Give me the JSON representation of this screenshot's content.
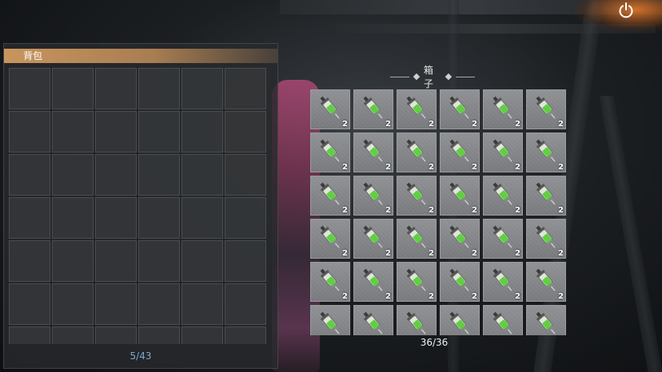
{
  "backpack": {
    "title": "背包",
    "capacity_text": "5/43",
    "visible_slot_count": 42
  },
  "box": {
    "title": "箱子",
    "capacity_text": "36/36",
    "item_icon": "green-syringe-icon",
    "slots": [
      {
        "qty": "2"
      },
      {
        "qty": "2"
      },
      {
        "qty": "2"
      },
      {
        "qty": "2"
      },
      {
        "qty": "2"
      },
      {
        "qty": "2"
      },
      {
        "qty": "2"
      },
      {
        "qty": "2"
      },
      {
        "qty": "2"
      },
      {
        "qty": "2"
      },
      {
        "qty": "2"
      },
      {
        "qty": "2"
      },
      {
        "qty": "2"
      },
      {
        "qty": "2"
      },
      {
        "qty": "2"
      },
      {
        "qty": "2"
      },
      {
        "qty": "2"
      },
      {
        "qty": "2"
      },
      {
        "qty": "2"
      },
      {
        "qty": "2"
      },
      {
        "qty": "2"
      },
      {
        "qty": "2"
      },
      {
        "qty": "2"
      },
      {
        "qty": "2"
      },
      {
        "qty": "2"
      },
      {
        "qty": "2"
      },
      {
        "qty": "2"
      },
      {
        "qty": "2"
      },
      {
        "qty": "2"
      },
      {
        "qty": "2"
      },
      {
        "qty": ""
      },
      {
        "qty": ""
      },
      {
        "qty": ""
      },
      {
        "qty": ""
      },
      {
        "qty": ""
      },
      {
        "qty": ""
      }
    ]
  },
  "toolbar": {
    "power_icon": "power-icon"
  },
  "colors": {
    "header_accent": "#c9955e",
    "backpack_count": "#7fa9c8",
    "syringe_green": "#5fd040"
  }
}
